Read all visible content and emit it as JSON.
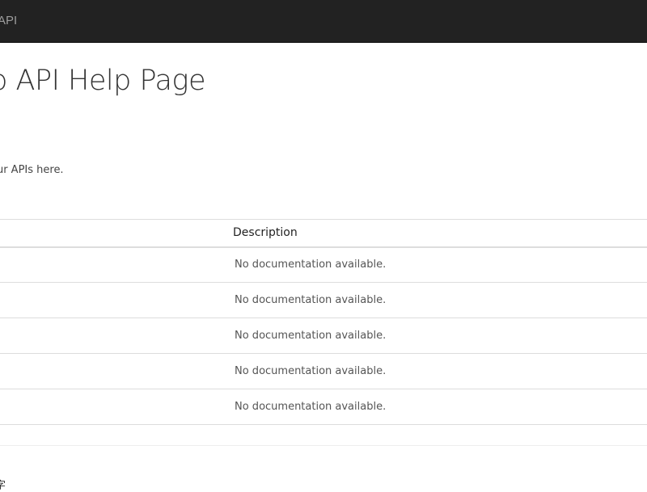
{
  "navbar": {
    "brand": "API"
  },
  "main": {
    "title": "o API Help Page",
    "intro": "our APIs here."
  },
  "table": {
    "headers": {
      "api": "",
      "description": "Description"
    },
    "rows": [
      {
        "api": "",
        "description": "No documentation available."
      },
      {
        "api": "",
        "description": "No documentation available."
      },
      {
        "api": "",
        "description": "No documentation available."
      },
      {
        "api": "",
        "description": "No documentation available."
      },
      {
        "api": "",
        "description": "No documentation available."
      }
    ]
  },
  "footer": {
    "text": "字"
  }
}
